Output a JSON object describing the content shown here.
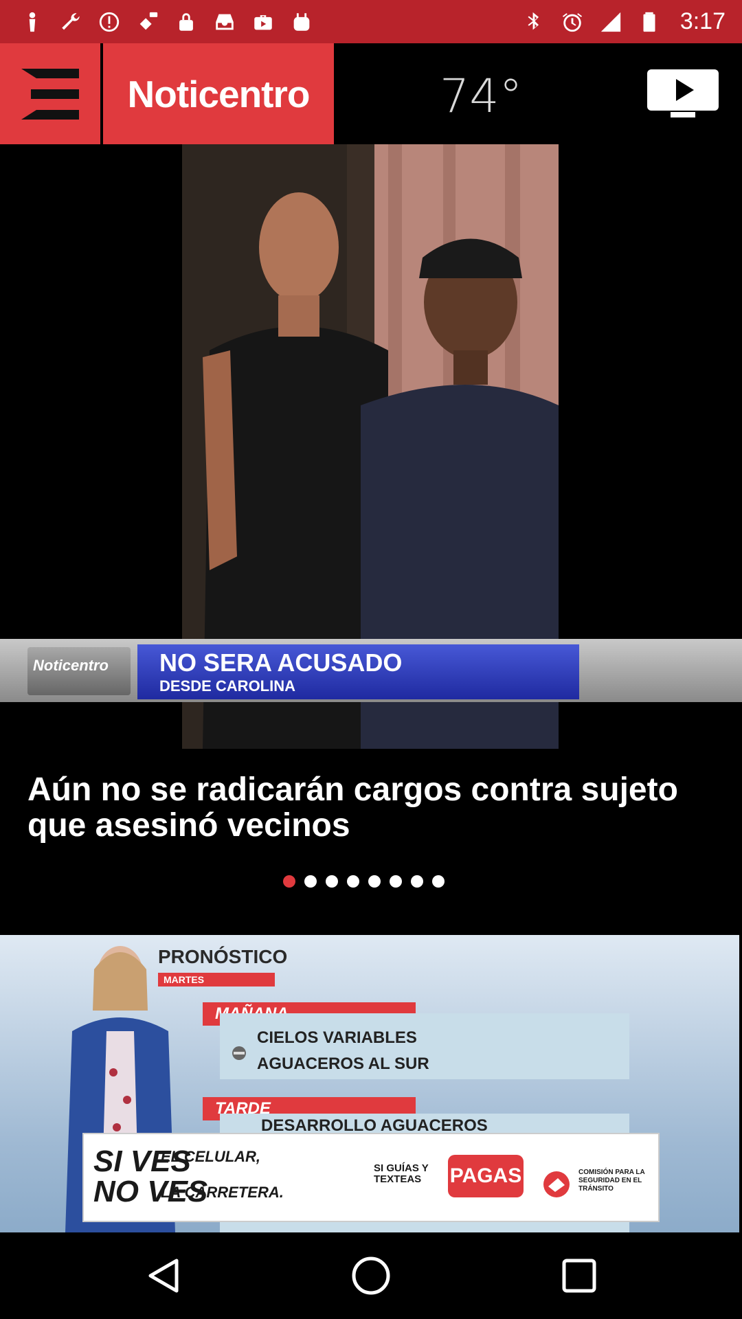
{
  "status_bar": {
    "time": "3:17",
    "left_icons": [
      "person-icon",
      "wrench-icon",
      "alert-icon",
      "fake-gps-icon",
      "lock-icon",
      "inbox-icon",
      "briefcase-icon",
      "bag-icon"
    ],
    "right_icons": [
      "bluetooth-icon",
      "alarm-icon",
      "signal-icon",
      "battery-icon"
    ]
  },
  "header": {
    "brand": "Noticentro",
    "temperature": "74°",
    "colors": {
      "brand_red": "#e03a3e",
      "status_red": "#b8232b"
    }
  },
  "hero": {
    "lower_third_logo": "Noticentro",
    "lower_third_line1": "NO SERA ACUSADO",
    "lower_third_line2": "DESDE CAROLINA"
  },
  "headline": "Aún no se radicarán cargos contra sujeto que asesinó vecinos",
  "carousel": {
    "total": 8,
    "active_index": 0
  },
  "forecast": {
    "title": "PRONÓSTICO",
    "day": "MARTES",
    "morning_label": "MAÑANA",
    "morning_line1": "CIELOS VARIABLES",
    "morning_line2": "AGUACEROS AL SUR",
    "afternoon_label": "TARDE",
    "afternoon_line1": "DESARROLLO AGUACEROS"
  },
  "ad": {
    "line_big1": "SI VES",
    "line_small1": "EL CELULAR,",
    "line_big2": "NO VES",
    "line_small2": "LA CARRETERA.",
    "mid_text": "SI GUÍAS Y TEXTEAS",
    "brand": "PAGAS",
    "commission": "COMISIÓN PARA LA SEGURIDAD EN EL TRÁNSITO"
  },
  "navbar": {
    "back": "back-icon",
    "home": "home-icon",
    "recents": "recents-icon"
  }
}
